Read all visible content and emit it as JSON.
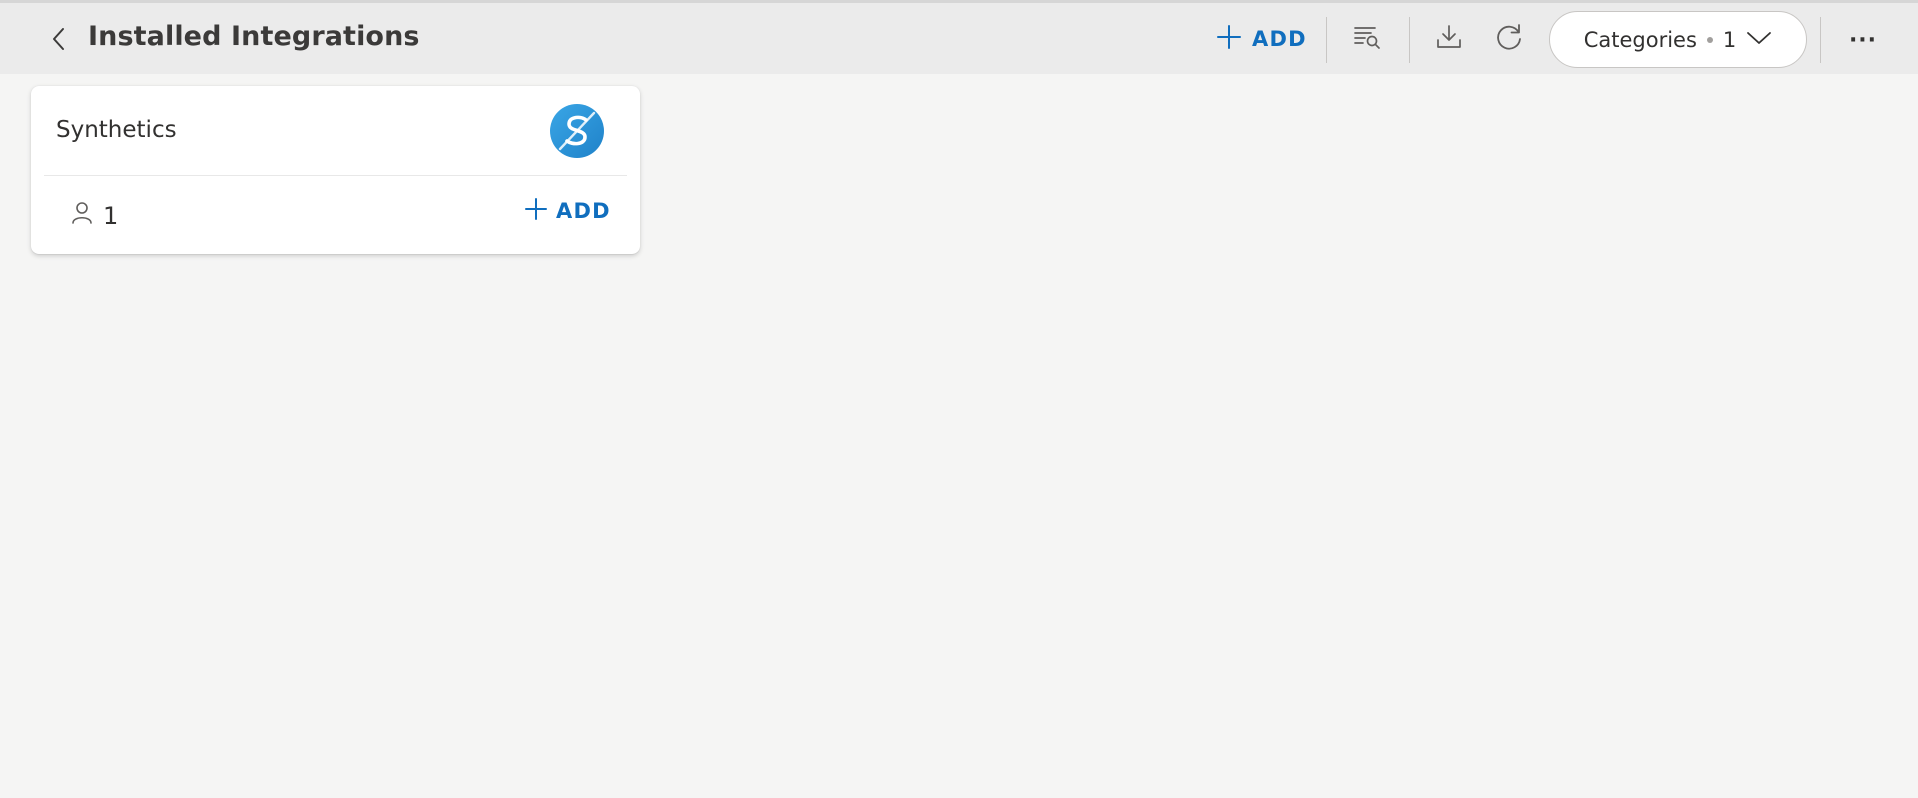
{
  "header": {
    "title": "Installed Integrations",
    "add_label": "ADD",
    "categories_label": "Categories",
    "categories_count": "1",
    "more_label": "···"
  },
  "icons": {
    "back": "chevron-left-icon",
    "add": "plus-icon",
    "filter": "filter-search-icon",
    "import": "download-tray-icon",
    "refresh": "refresh-icon",
    "dropdown": "chevron-down-icon",
    "more": "ellipsis-icon",
    "user": "person-icon",
    "logo": "synthetics-logo-icon"
  },
  "cards": [
    {
      "name": "Synthetics",
      "user_count": "1",
      "add_label": "ADD"
    }
  ],
  "colors": {
    "accent": "#106ebe",
    "header_bg": "#ebebeb",
    "page_bg": "#f5f5f4",
    "logo_blue": "#2f97d8"
  }
}
